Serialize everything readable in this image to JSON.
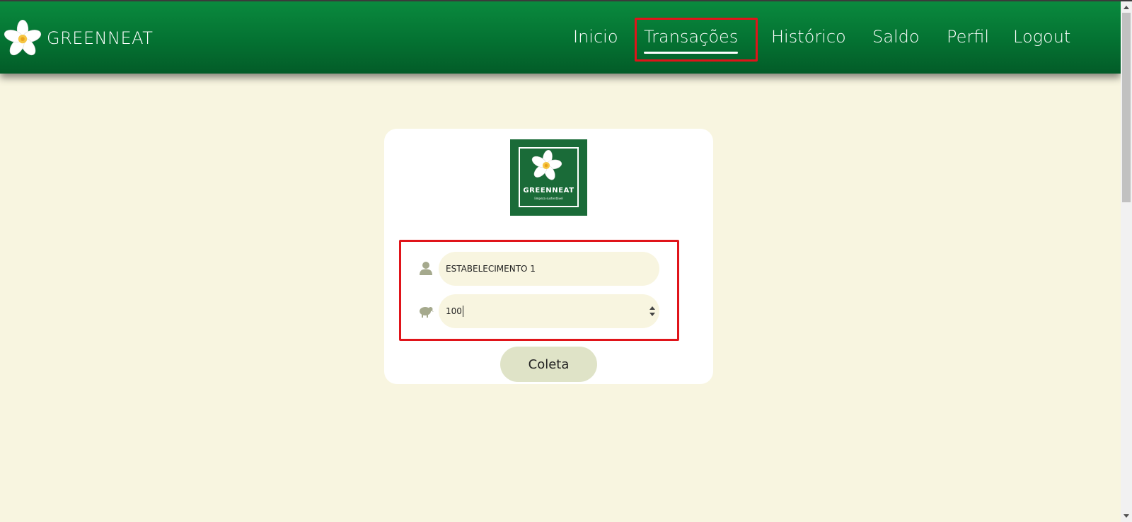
{
  "navbar": {
    "brand": "GREENNEAT",
    "items": [
      {
        "label": "Inicio"
      },
      {
        "label": "Transações"
      },
      {
        "label": "Histórico"
      },
      {
        "label": "Saldo"
      },
      {
        "label": "Perfil"
      },
      {
        "label": "Logout"
      }
    ],
    "active": "Transações"
  },
  "logo": {
    "title": "GREENNEAT",
    "subtitle": "limpeza sustentável"
  },
  "form": {
    "establishment_value": "ESTABELECIMENTO 1",
    "quantity_value": "100",
    "submit_label": "Coleta"
  },
  "icons": {
    "brand": "plumeria-flower-icon",
    "establishment": "user-icon",
    "quantity": "animal-icon"
  },
  "colors": {
    "navbar": "#047232",
    "background": "#f8f5e0",
    "highlight": "#e0141a",
    "button": "#dfe3c7",
    "logo_bg": "#1a6b38"
  }
}
